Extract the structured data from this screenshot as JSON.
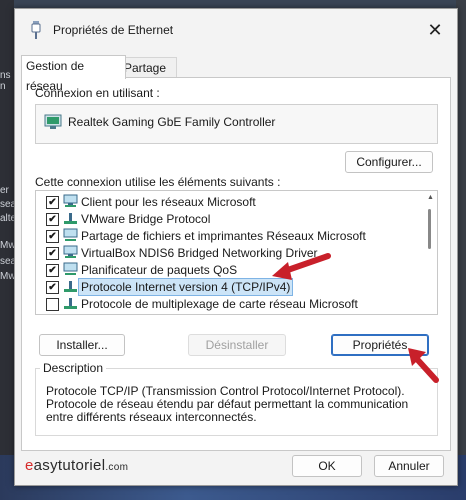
{
  "window": {
    "title": "Propriétés de Ethernet",
    "close_symbol": "✕"
  },
  "tabs": [
    {
      "label": "Gestion de réseau",
      "active": true
    },
    {
      "label": "Partage",
      "active": false
    }
  ],
  "connection": {
    "label": "Connexion en utilisant :",
    "adapter": "Realtek Gaming GbE Family Controller",
    "configure_button": "Configurer..."
  },
  "components": {
    "label": "Cette connexion utilise les éléments suivants :",
    "items": [
      {
        "label": "Client pour les réseaux Microsoft",
        "checked": true,
        "icon": "network-client-icon"
      },
      {
        "label": "VMware Bridge Protocol",
        "checked": true,
        "icon": "protocol-icon"
      },
      {
        "label": "Partage de fichiers et imprimantes Réseaux Microsoft",
        "checked": true,
        "icon": "service-icon"
      },
      {
        "label": "VirtualBox NDIS6 Bridged Networking Driver",
        "checked": true,
        "icon": "network-client-icon"
      },
      {
        "label": "Planificateur de paquets QoS",
        "checked": true,
        "icon": "service-icon"
      },
      {
        "label": "Protocole Internet version 4 (TCP/IPv4)",
        "checked": true,
        "icon": "protocol-icon",
        "selected": true
      },
      {
        "label": "Protocole de multiplexage de carte réseau Microsoft",
        "checked": false,
        "icon": "protocol-icon"
      }
    ]
  },
  "actions": {
    "install": "Installer...",
    "uninstall": "Désinstaller",
    "properties": "Propriétés"
  },
  "description": {
    "title": "Description",
    "text": "Protocole TCP/IP (Transmission Control Protocol/Internet Protocol). Protocole de réseau étendu par défaut permettant la communication entre différents réseaux interconnectés."
  },
  "footer": {
    "ok": "OK",
    "cancel": "Annuler"
  },
  "watermark": {
    "prefix": "e",
    "name": "asytutoriel",
    "suffix": ".com"
  },
  "background_fragments": [
    "rs",
    "ns n",
    "er",
    "sea",
    "alte",
    "Mw",
    "sea",
    "Mw"
  ],
  "colors": {
    "accent": "#2f6fc2",
    "selection": "#cce4f7",
    "arrow": "#c8202a"
  }
}
